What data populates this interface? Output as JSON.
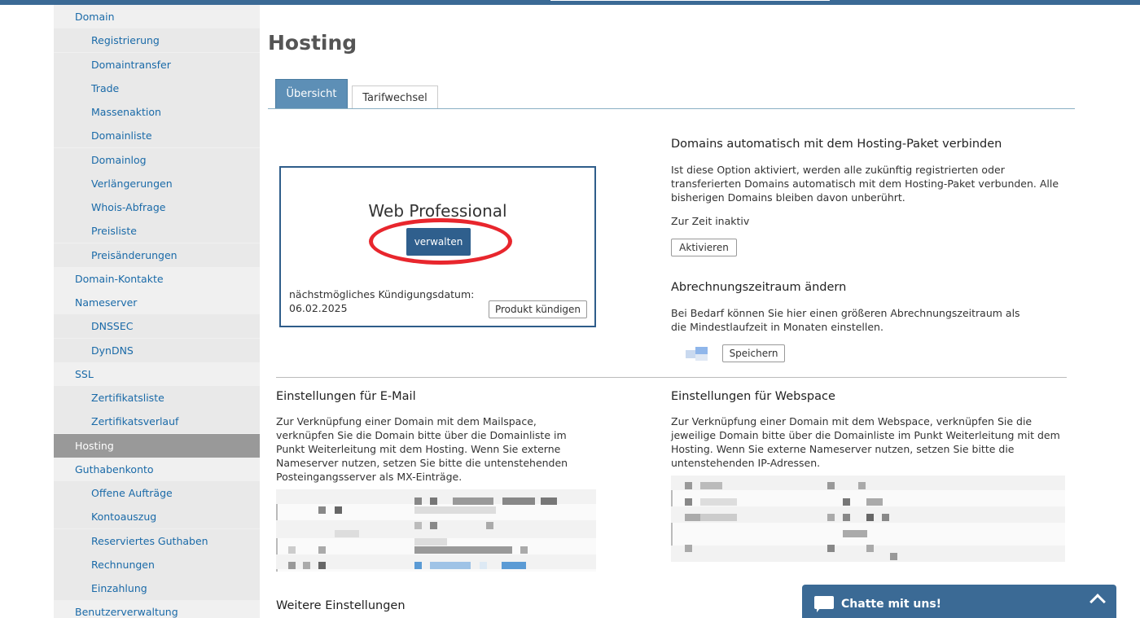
{
  "sidebar": {
    "items": [
      {
        "label": "Domain",
        "level": 1
      },
      {
        "label": "Registrierung",
        "level": 2
      },
      {
        "label": "Domaintransfer",
        "level": 2
      },
      {
        "label": "Trade",
        "level": 2
      },
      {
        "label": "Massenaktion",
        "level": 2
      },
      {
        "label": "Domainliste",
        "level": 2
      },
      {
        "label": "Domainlog",
        "level": 2
      },
      {
        "label": "Verlängerungen",
        "level": 2
      },
      {
        "label": "Whois-Abfrage",
        "level": 2
      },
      {
        "label": "Preisliste",
        "level": 2
      },
      {
        "label": "Preisänderungen",
        "level": 2
      },
      {
        "label": "Domain-Kontakte",
        "level": 1
      },
      {
        "label": "Nameserver",
        "level": 1
      },
      {
        "label": "DNSSEC",
        "level": 2
      },
      {
        "label": "DynDNS",
        "level": 2
      },
      {
        "label": "SSL",
        "level": 1
      },
      {
        "label": "Zertifikatsliste",
        "level": 2
      },
      {
        "label": "Zertifikatsverlauf",
        "level": 2
      },
      {
        "label": "Hosting",
        "level": 1,
        "active": true
      },
      {
        "label": "Guthabenkonto",
        "level": 1
      },
      {
        "label": "Offene Aufträge",
        "level": 2
      },
      {
        "label": "Kontoauszug",
        "level": 2
      },
      {
        "label": "Reserviertes Guthaben",
        "level": 2
      },
      {
        "label": "Rechnungen",
        "level": 2
      },
      {
        "label": "Einzahlung",
        "level": 2
      },
      {
        "label": "Benutzerverwaltung",
        "level": 1
      }
    ]
  },
  "page": {
    "title": "Hosting"
  },
  "tabs": [
    {
      "label": "Übersicht",
      "active": true
    },
    {
      "label": "Tarifwechsel",
      "active": false
    }
  ],
  "product": {
    "name": "Web Professional",
    "manage_label": "verwalten",
    "cancel_date_label": "nächstmögliches Kündigungsdatum:",
    "cancel_date": "06.02.2025",
    "cancel_button": "Produkt kündigen"
  },
  "auto_connect": {
    "title": "Domains automatisch mit dem Hosting-Paket verbinden",
    "text": "Ist diese Option aktiviert, werden alle zukünftig registrierten oder transferierten Domains automatisch mit dem Hosting-Paket verbunden. Alle bisherigen Domains bleiben davon unberührt.",
    "status": "Zur Zeit inaktiv",
    "button": "Aktivieren"
  },
  "billing": {
    "title": "Abrechnungszeitraum ändern",
    "text": "Bei Bedarf können Sie hier einen größeren Abrechnungszeitraum als die Mindestlaufzeit in Monaten einstellen.",
    "button": "Speichern"
  },
  "email": {
    "title": "Einstellungen für E-Mail",
    "text": "Zur Verknüpfung einer Domain mit dem Mailspace, verknüpfen Sie die Domain bitte über die Domainliste im Punkt Weiterleitung mit dem Hosting. Wenn Sie externe Nameserver nutzen, setzen Sie bitte die untenstehenden Posteingangsserver als MX-Einträge."
  },
  "webspace": {
    "title": "Einstellungen für Webspace",
    "text": "Zur Verknüpfung einer Domain mit dem Webspace, verknüpfen Sie die jeweilige Domain bitte über die Domainliste im Punkt Weiterleitung mit dem Hosting. Wenn Sie externe Nameserver nutzen, setzen Sie bitte die untenstehenden IP-Adressen."
  },
  "more": {
    "title": "Weitere Einstellungen"
  },
  "chat": {
    "label": "Chatte mit uns!"
  },
  "colors": {
    "accent": "#3b6a95",
    "highlight_ring": "#e8262d",
    "sidebar_active": "#999999",
    "link": "#1a6aa8"
  }
}
